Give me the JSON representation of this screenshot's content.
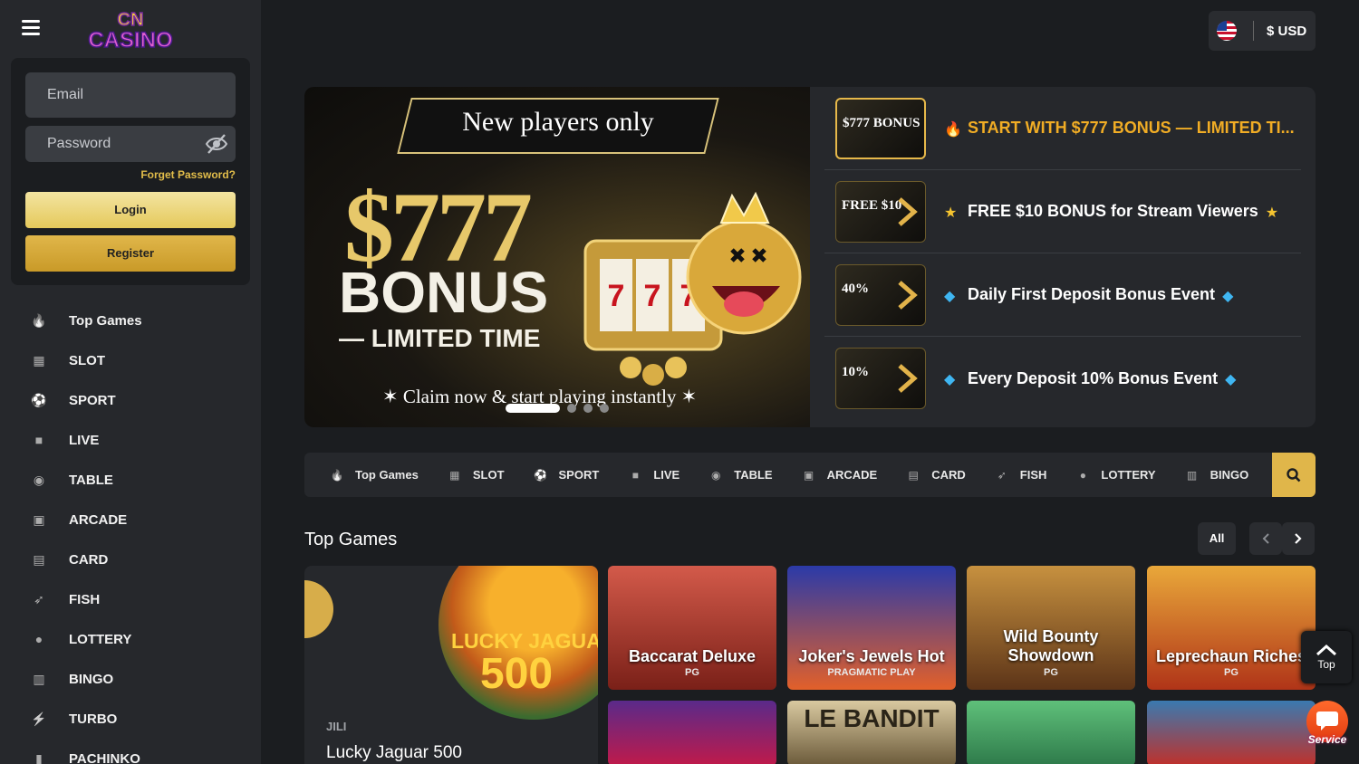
{
  "header": {
    "currency_label": "$ USD",
    "flag_icon": "us-flag-icon"
  },
  "brand": {
    "logo_text": "CN CASINO"
  },
  "login": {
    "email_placeholder": "Email",
    "password_placeholder": "Password",
    "forget_label": "Forget Password?",
    "login_label": "Login",
    "register_label": "Register"
  },
  "sidebar": {
    "items": [
      {
        "label": "Top Games",
        "icon": "fire-icon"
      },
      {
        "label": "SLOT",
        "icon": "slot-icon"
      },
      {
        "label": "SPORT",
        "icon": "soccer-ball-icon"
      },
      {
        "label": "LIVE",
        "icon": "camera-icon"
      },
      {
        "label": "TABLE",
        "icon": "roulette-icon"
      },
      {
        "label": "ARCADE",
        "icon": "arcade-icon"
      },
      {
        "label": "CARD",
        "icon": "cards-icon"
      },
      {
        "label": "FISH",
        "icon": "fish-icon"
      },
      {
        "label": "LOTTERY",
        "icon": "lottery-ball-icon"
      },
      {
        "label": "BINGO",
        "icon": "bingo-icon"
      },
      {
        "label": "TURBO",
        "icon": "lightning-icon"
      },
      {
        "label": "PACHINKO",
        "icon": "pachinko-icon"
      }
    ]
  },
  "banner": {
    "headline": "New players only",
    "amount": "$777",
    "bonus_word": "BONUS",
    "limited": "— LIMITED TIME",
    "cta": "✶ Claim now & start playing instantly ✶",
    "slides_total": 4,
    "active_slide": 1
  },
  "promos": [
    {
      "label": "START WITH $777 BONUS — LIMITED TI...",
      "thumb": "$777 BONUS",
      "icon": "fire-icon",
      "highlighted": true
    },
    {
      "label": "FREE $10 BONUS for Stream Viewers",
      "thumb": "FREE $10",
      "icon": "star-icon",
      "highlighted": false
    },
    {
      "label": "Daily First Deposit Bonus Event",
      "thumb": "40%",
      "icon": "diamond-icon",
      "highlighted": false
    },
    {
      "label": "Every Deposit 10% Bonus Event",
      "thumb": "10%",
      "icon": "diamond-icon",
      "highlighted": false
    }
  ],
  "categories": [
    {
      "label": "Top Games",
      "icon": "fire-icon"
    },
    {
      "label": "SLOT",
      "icon": "slot-icon"
    },
    {
      "label": "SPORT",
      "icon": "soccer-ball-icon"
    },
    {
      "label": "LIVE",
      "icon": "camera-icon"
    },
    {
      "label": "TABLE",
      "icon": "roulette-icon"
    },
    {
      "label": "ARCADE",
      "icon": "arcade-icon"
    },
    {
      "label": "CARD",
      "icon": "cards-icon"
    },
    {
      "label": "FISH",
      "icon": "fish-icon"
    },
    {
      "label": "LOTTERY",
      "icon": "lottery-ball-icon"
    },
    {
      "label": "BINGO",
      "icon": "bingo-icon"
    }
  ],
  "top_games": {
    "title": "Top Games",
    "all_label": "All",
    "featured": {
      "provider": "JILI",
      "name": "Lucky Jaguar 500",
      "art_line1": "LUCKY JAGUAR",
      "art_line2": "500"
    },
    "games": [
      {
        "name": "Baccarat Deluxe",
        "provider": "PG",
        "colors": [
          "#d35a4a",
          "#7a2018"
        ]
      },
      {
        "name": "Joker's Jewels Hot",
        "provider": "PRAGMATIC PLAY",
        "colors": [
          "#2b3aa8",
          "#e2602a"
        ]
      },
      {
        "name": "Wild Bounty Showdown",
        "provider": "PG",
        "colors": [
          "#c7913f",
          "#5c3418"
        ]
      },
      {
        "name": "Leprechaun Riches",
        "provider": "PG",
        "colors": [
          "#e9a83a",
          "#b03418"
        ]
      }
    ],
    "row2": [
      {
        "art": "joker-art",
        "colors": [
          "#5a2a8a",
          "#c01a4a"
        ]
      },
      {
        "art": "LE BANDIT",
        "colors": [
          "#d9c9a0",
          "#6b5a3a"
        ]
      },
      {
        "art": "raccoon-art",
        "colors": [
          "#5fc07a",
          "#2e7a4a"
        ]
      },
      {
        "art": "dragon-art",
        "colors": [
          "#3a7ab0",
          "#c0302a"
        ]
      }
    ]
  },
  "floating": {
    "top_label": "Top",
    "service_label": "Service"
  }
}
